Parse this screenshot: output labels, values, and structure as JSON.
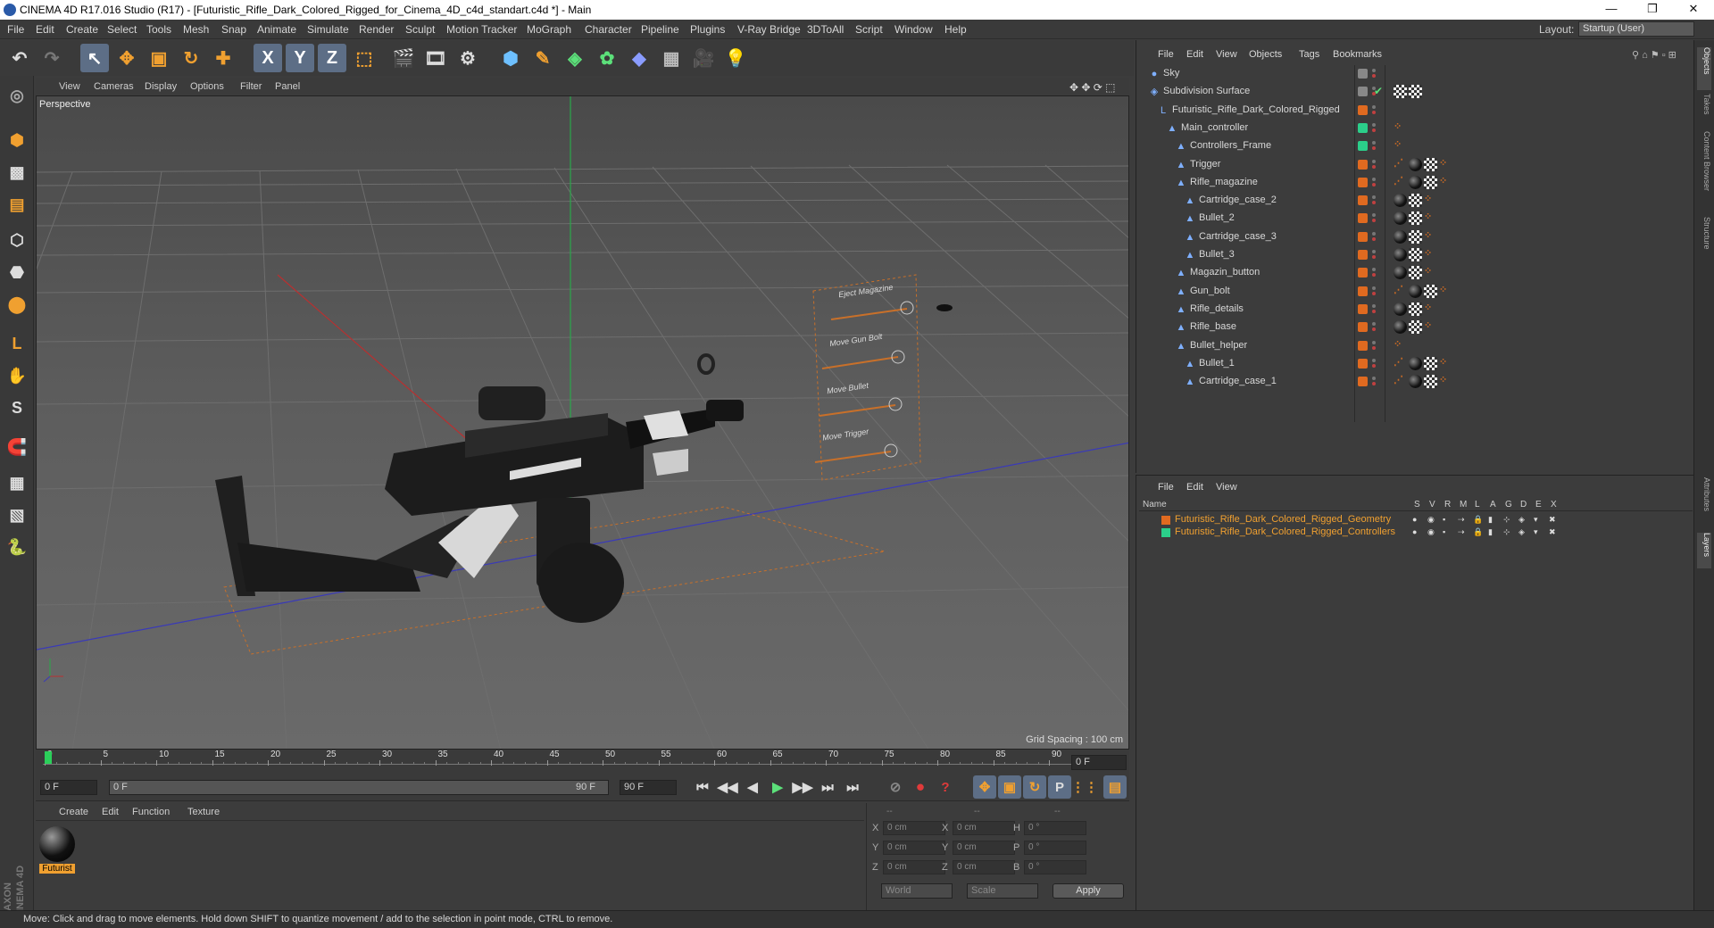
{
  "window": {
    "title": "CINEMA 4D R17.016 Studio (R17) - [Futuristic_Rifle_Dark_Colored_Rigged_for_Cinema_4D_c4d_standart.c4d *] - Main",
    "min": "—",
    "max": "❐",
    "close": "✕"
  },
  "menu": [
    "File",
    "Edit",
    "Create",
    "Select",
    "Tools",
    "Mesh",
    "Snap",
    "Animate",
    "Simulate",
    "Render",
    "Sculpt",
    "Motion Tracker",
    "MoGraph",
    "Character",
    "Pipeline",
    "Plugins",
    "V-Ray Bridge",
    "3DToAll",
    "Script",
    "Window",
    "Help"
  ],
  "layout": {
    "label": "Layout:",
    "value": "Startup (User)"
  },
  "toolbar": {
    "undo": "↶",
    "redo": "↷",
    "select": "↖",
    "move": "✥",
    "scale": "▣",
    "rotate": "↻",
    "new": "✚",
    "x": "X",
    "y": "Y",
    "z": "Z",
    "coord": "⬚",
    "render_view": "🎬",
    "render": "🎞",
    "render_settings": "⚙",
    "cube": "⬢",
    "pen": "✎",
    "subdiv": "◈",
    "array": "✿",
    "deform": "◆",
    "floor": "▦",
    "camera": "🎥",
    "light": "💡"
  },
  "left_tools": [
    "◎",
    "⬢",
    "▩",
    "▤",
    "⬡",
    "⬣",
    "⬤",
    "L",
    "✋",
    "S",
    "🧲",
    "▦",
    "▧",
    "🐍"
  ],
  "viewport": {
    "menu": [
      "View",
      "Cameras",
      "Display",
      "Options",
      "Filter",
      "Panel"
    ],
    "label": "Perspective",
    "grid_spacing": "Grid Spacing : 100 cm",
    "nav_icons": "✥ ✥ ⟳ ⬚",
    "controls": [
      {
        "label": "Eject Magazine"
      },
      {
        "label": "Move Gun Bolt"
      },
      {
        "label": "Move Bullet"
      },
      {
        "label": "Move Trigger"
      }
    ]
  },
  "timeline": {
    "ticks": [
      "0",
      "5",
      "10",
      "15",
      "20",
      "25",
      "30",
      "35",
      "40",
      "45",
      "50",
      "55",
      "60",
      "65",
      "70",
      "75",
      "80",
      "85",
      "90"
    ],
    "frame_field": "0 F"
  },
  "transport": {
    "start": "0 F",
    "range_start": "0 F",
    "range_end": "90 F",
    "end": "90 F",
    "buttons": [
      "⏮",
      "◀◀",
      "◀",
      "▶",
      "▶▶",
      "⏭",
      "⏭"
    ],
    "keys": [
      "⊘",
      "⏺",
      "?",
      "✥",
      "▣",
      "↻",
      "P",
      "⋮⋮"
    ]
  },
  "materials": {
    "menu": [
      "Create",
      "Edit",
      "Function",
      "Texture"
    ],
    "items": [
      {
        "name": "Futurist"
      }
    ]
  },
  "coords": {
    "headers": [
      "--",
      "--",
      "--"
    ],
    "rows": [
      {
        "l1": "X",
        "v1": "0 cm",
        "l2": "X",
        "v2": "0 cm",
        "l3": "H",
        "v3": "0 °"
      },
      {
        "l1": "Y",
        "v1": "0 cm",
        "l2": "Y",
        "v2": "0 cm",
        "l3": "P",
        "v3": "0 °"
      },
      {
        "l1": "Z",
        "v1": "0 cm",
        "l2": "Z",
        "v2": "0 cm",
        "l3": "B",
        "v3": "0 °"
      }
    ],
    "mode1": "World",
    "mode2": "Scale",
    "apply": "Apply"
  },
  "status": "Move: Click and drag to move elements. Hold down SHIFT to quantize movement / add to the selection in point mode, CTRL to remove.",
  "object_manager": {
    "menu": [
      "File",
      "Edit",
      "View",
      "Objects",
      "Tags",
      "Bookmarks"
    ],
    "objects": [
      {
        "name": "Sky",
        "depth": 0,
        "icon": "●",
        "color": "#888888",
        "tags": ""
      },
      {
        "name": "Subdivision Surface",
        "depth": 0,
        "icon": "◈",
        "color": "#888888",
        "tags": "check"
      },
      {
        "name": "Futuristic_Rifle_Dark_Colored_Rigged",
        "depth": 1,
        "icon": "L",
        "color": "#e06a20",
        "tags": ""
      },
      {
        "name": "Main_controller",
        "depth": 2,
        "icon": "▲",
        "color": "#2bcf8a",
        "tags": "d"
      },
      {
        "name": "Controllers_Frame",
        "depth": 3,
        "icon": "▲",
        "color": "#2bcf8a",
        "tags": "d"
      },
      {
        "name": "Trigger",
        "depth": 3,
        "icon": "▲",
        "color": "#e06a20",
        "tags": "xscd"
      },
      {
        "name": "Rifle_magazine",
        "depth": 3,
        "icon": "▲",
        "color": "#e06a20",
        "tags": "xscd"
      },
      {
        "name": "Cartridge_case_2",
        "depth": 4,
        "icon": "▲",
        "color": "#e06a20",
        "tags": "scd"
      },
      {
        "name": "Bullet_2",
        "depth": 4,
        "icon": "▲",
        "color": "#e06a20",
        "tags": "scd"
      },
      {
        "name": "Cartridge_case_3",
        "depth": 4,
        "icon": "▲",
        "color": "#e06a20",
        "tags": "scd"
      },
      {
        "name": "Bullet_3",
        "depth": 4,
        "icon": "▲",
        "color": "#e06a20",
        "tags": "scd"
      },
      {
        "name": "Magazin_button",
        "depth": 3,
        "icon": "▲",
        "color": "#e06a20",
        "tags": "scd"
      },
      {
        "name": "Gun_bolt",
        "depth": 3,
        "icon": "▲",
        "color": "#e06a20",
        "tags": "xscd"
      },
      {
        "name": "Rifle_details",
        "depth": 3,
        "icon": "▲",
        "color": "#e06a20",
        "tags": "scd"
      },
      {
        "name": "Rifle_base",
        "depth": 3,
        "icon": "▲",
        "color": "#e06a20",
        "tags": "scd"
      },
      {
        "name": "Bullet_helper",
        "depth": 3,
        "icon": "▲",
        "color": "#e06a20",
        "tags": "d"
      },
      {
        "name": "Bullet_1",
        "depth": 4,
        "icon": "▲",
        "color": "#e06a20",
        "tags": "xscd"
      },
      {
        "name": "Cartridge_case_1",
        "depth": 4,
        "icon": "▲",
        "color": "#e06a20",
        "tags": "xscd"
      }
    ]
  },
  "layer_manager": {
    "menu": [
      "File",
      "Edit",
      "View"
    ],
    "columns": [
      "Name",
      "S",
      "V",
      "R",
      "M",
      "L",
      "A",
      "G",
      "D",
      "E",
      "X"
    ],
    "layers": [
      {
        "name": "Futuristic_Rifle_Dark_Colored_Rigged_Geometry",
        "color": "#e06a20"
      },
      {
        "name": "Futuristic_Rifle_Dark_Colored_Rigged_Controllers",
        "color": "#2bcf8a"
      }
    ]
  },
  "right_tabs": [
    "Objects",
    "Takes",
    "Content Browser",
    "Structure",
    "Attributes",
    "Layers"
  ],
  "maxon_logo": "MAXON CINEMA 4D"
}
